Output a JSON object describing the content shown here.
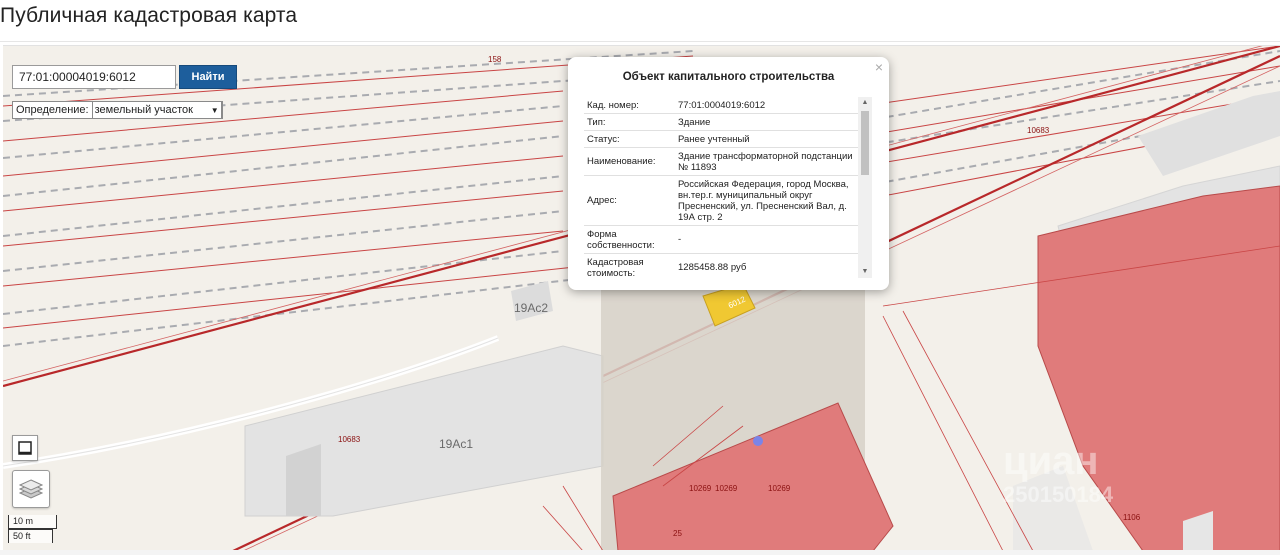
{
  "page": {
    "title": "Публичная кадастровая карта"
  },
  "search": {
    "value": "77:01:00004019:6012",
    "button_label": "Найти"
  },
  "definition": {
    "label": "Определение:",
    "selected": "земельный участок"
  },
  "popup": {
    "title": "Объект капитального строительства",
    "close": "×",
    "rows": [
      {
        "key": "Кад. номер:",
        "value": "77:01:0004019:6012"
      },
      {
        "key": "Тип:",
        "value": "Здание"
      },
      {
        "key": "Статус:",
        "value": "Ранее учтенный"
      },
      {
        "key": "Наименование:",
        "value": "Здание трансформаторной подстанции № 11893"
      },
      {
        "key": "Адрес:",
        "value": "Российская Федерация, город Москва, вн.тер.г. муниципальный округ Пресненский, ул. Пресненский Вал, д. 19А стр. 2"
      },
      {
        "key": "Форма собственности:",
        "value": "-"
      },
      {
        "key": "Кадастровая стоимость:",
        "value": "1285458.88 руб"
      }
    ]
  },
  "map": {
    "buildings": [
      "19Ас2",
      "19Ас1"
    ],
    "parcel_numbers": [
      "158",
      "10683",
      "10683",
      "10269",
      "10269",
      "10269",
      "25",
      "1106",
      "6012"
    ],
    "watermark_logo": "циан",
    "watermark_id": "250150184"
  },
  "scale": {
    "metric": "10 m",
    "imperial": "50 ft"
  },
  "colors": {
    "parcel_red": "#e07b7b",
    "boundary": "#c0392b",
    "button": "#1d5e9c",
    "highlight": "#f0c832"
  }
}
